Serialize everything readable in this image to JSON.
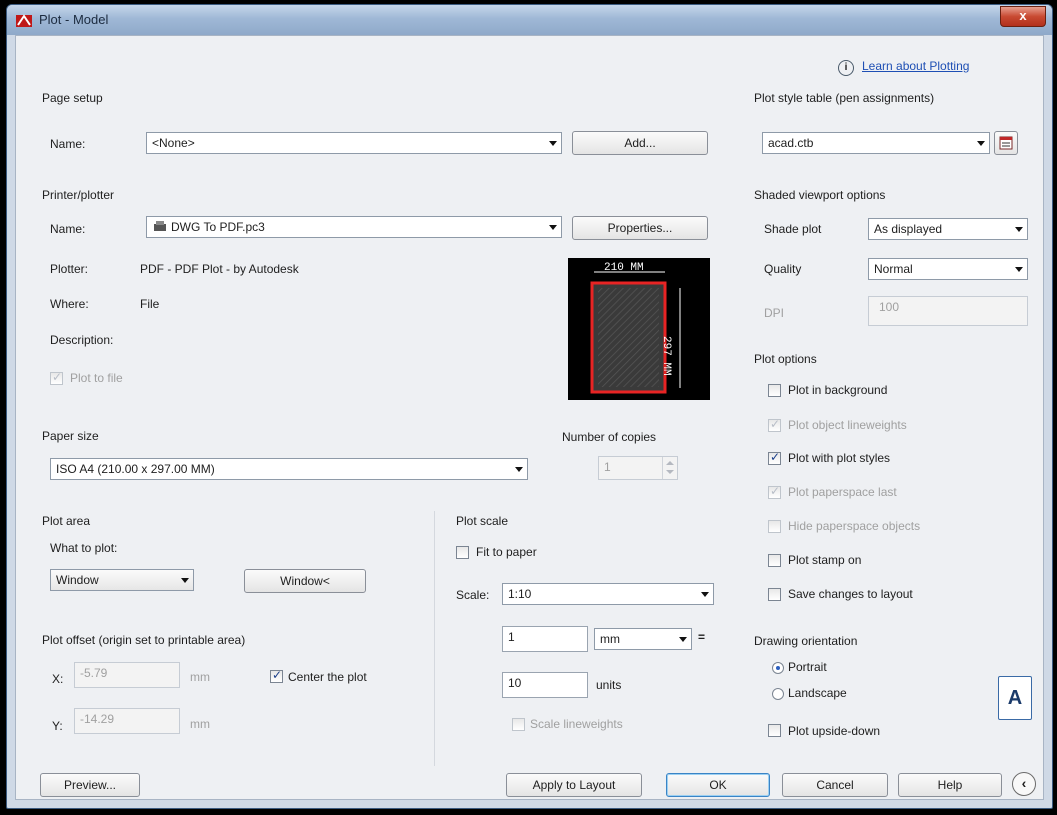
{
  "window": {
    "title": "Plot - Model",
    "close": "x"
  },
  "help_link": "Learn about Plotting",
  "page_setup": {
    "heading": "Page setup",
    "name_label": "Name:",
    "name_value": "<None>",
    "add_button": "Add..."
  },
  "printer": {
    "heading": "Printer/plotter",
    "name_label": "Name:",
    "name_value": "DWG To PDF.pc3",
    "properties_button": "Properties...",
    "plotter_label": "Plotter:",
    "plotter_value": "PDF - PDF Plot - by Autodesk",
    "where_label": "Where:",
    "where_value": "File",
    "description_label": "Description:",
    "plot_to_file": "Plot to file"
  },
  "preview_image": {
    "width_text": "210 MM",
    "height_text": "297 MM"
  },
  "paper_size": {
    "heading": "Paper size",
    "value": "ISO A4 (210.00 x 297.00 MM)"
  },
  "copies": {
    "label": "Number of copies",
    "value": "1"
  },
  "plot_area": {
    "heading": "Plot area",
    "what_label": "What to plot:",
    "what_value": "Window",
    "window_button": "Window<"
  },
  "plot_offset": {
    "heading": "Plot offset (origin set to printable area)",
    "x_label": "X:",
    "x_value": "-5.79",
    "x_unit": "mm",
    "y_label": "Y:",
    "y_value": "-14.29",
    "y_unit": "mm",
    "center_label": "Center the plot"
  },
  "plot_scale": {
    "heading": "Plot scale",
    "fit_label": "Fit to paper",
    "scale_label": "Scale:",
    "scale_value": "1:10",
    "num_value": "1",
    "unit_value": "mm",
    "equals": "=",
    "units_value": "10",
    "units_label": "units",
    "lineweights_label": "Scale lineweights"
  },
  "plot_style": {
    "heading": "Plot style table (pen assignments)",
    "value": "acad.ctb"
  },
  "shaded": {
    "heading": "Shaded viewport options",
    "shade_label": "Shade plot",
    "shade_value": "As displayed",
    "quality_label": "Quality",
    "quality_value": "Normal",
    "dpi_label": "DPI",
    "dpi_value": "100"
  },
  "plot_options": {
    "heading": "Plot options",
    "items": [
      {
        "label": "Plot in background",
        "checked": false,
        "enabled": true
      },
      {
        "label": "Plot object lineweights",
        "checked": true,
        "enabled": false
      },
      {
        "label": "Plot with plot styles",
        "checked": true,
        "enabled": true
      },
      {
        "label": "Plot paperspace last",
        "checked": true,
        "enabled": false
      },
      {
        "label": "Hide paperspace objects",
        "checked": false,
        "enabled": false
      },
      {
        "label": "Plot stamp on",
        "checked": false,
        "enabled": true
      },
      {
        "label": "Save changes to layout",
        "checked": false,
        "enabled": true
      }
    ]
  },
  "orientation": {
    "heading": "Drawing orientation",
    "portrait": "Portrait",
    "landscape": "Landscape",
    "upside_down": "Plot upside-down",
    "icon_letter": "A"
  },
  "buttons": {
    "preview": "Preview...",
    "apply": "Apply to Layout",
    "ok": "OK",
    "cancel": "Cancel",
    "help": "Help"
  },
  "colors": {
    "accent_red": "#e82424",
    "link_blue": "#1e4fb4"
  }
}
